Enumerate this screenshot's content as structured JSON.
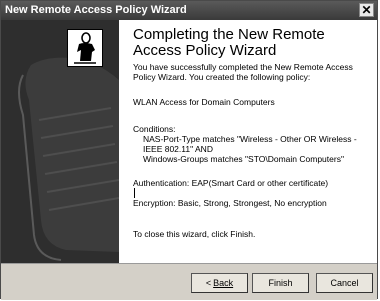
{
  "window": {
    "title": "New Remote Access Policy Wizard"
  },
  "heading": {
    "line1": "Completing the New Remote",
    "line2": "Access Policy Wizard"
  },
  "body": {
    "intro_line1": "You have successfully completed the New Remote Access",
    "intro_line2": "Policy Wizard. You created the following policy:",
    "policy_name": "WLAN Access for Domain Computers",
    "conditions_label": "Conditions:",
    "condition_1a": "NAS-Port-Type matches \"Wireless - Other OR Wireless -",
    "condition_1b": "IEEE 802.11\" AND",
    "condition_2": "Windows-Groups matches \"STO\\Domain Computers\"",
    "authentication": "Authentication: EAP(Smart Card or other certificate)",
    "encryption": "Encryption: Basic, Strong, Strongest, No encryption",
    "close_instruction": "To close this wizard, click Finish."
  },
  "buttons": {
    "back_arrow": "<",
    "back_label": "Back",
    "finish_label": "Finish",
    "cancel_label": "Cancel"
  },
  "icons": {
    "close": "close-icon",
    "wizard": "wizard-figure-icon",
    "art": "scroll-document-art"
  }
}
